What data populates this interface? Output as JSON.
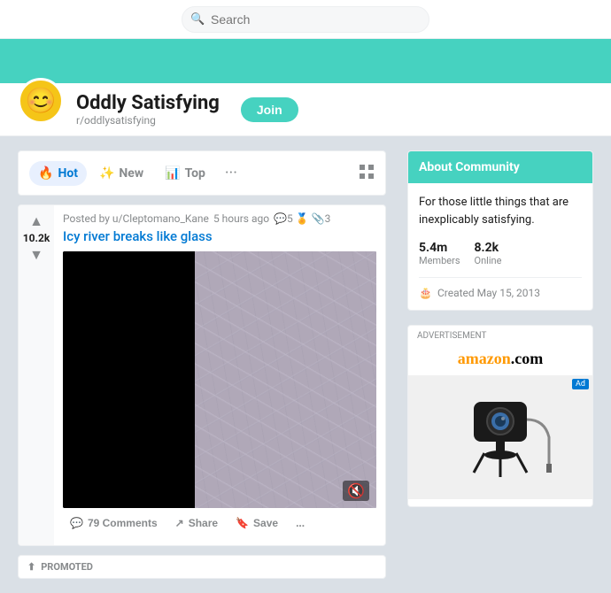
{
  "topbar": {
    "search_placeholder": "Search"
  },
  "community": {
    "name": "Oddly Satisfying",
    "slug": "r/oddlysatisfying",
    "join_label": "Join",
    "icon_emoji": "😊"
  },
  "sort_bar": {
    "items": [
      {
        "label": "Hot",
        "icon": "hot",
        "active": true
      },
      {
        "label": "New",
        "icon": "new",
        "active": false
      },
      {
        "label": "Top",
        "icon": "top",
        "active": false
      }
    ]
  },
  "post": {
    "vote_count": "10.2k",
    "meta_text": "Posted by u/Cleptomano_Kane",
    "meta_time": "5 hours ago",
    "title": "Icy river breaks like glass",
    "comments_label": "79 Comments",
    "share_label": "Share",
    "save_label": "Save",
    "more_label": "..."
  },
  "sidebar": {
    "about_header": "About Community",
    "about_desc": "For those little things that are inexplicably satisfying.",
    "members_count": "5.4m",
    "members_label": "Members",
    "online_count": "8.2k",
    "online_label": "Online",
    "created_text": "Created May 15, 2013"
  },
  "ad": {
    "label": "ADVERTISEMENT",
    "badge": "Ad"
  },
  "promoted": {
    "label": "PROMOTED"
  }
}
